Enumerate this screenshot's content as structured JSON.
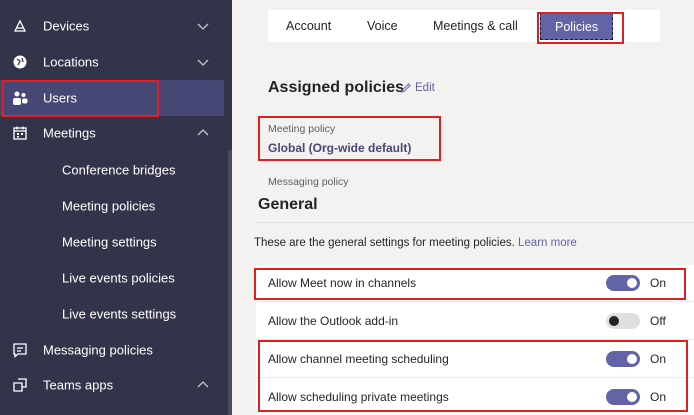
{
  "sidebar": {
    "items": [
      {
        "label": "Devices",
        "icon": "devices-icon",
        "chevron": "down"
      },
      {
        "label": "Locations",
        "icon": "globe-icon",
        "chevron": "down"
      },
      {
        "label": "Users",
        "icon": "users-icon",
        "active": true
      },
      {
        "label": "Meetings",
        "icon": "calendar-icon",
        "chevron": "up"
      },
      {
        "label": "Conference bridges",
        "sub": true
      },
      {
        "label": "Meeting policies",
        "sub": true
      },
      {
        "label": "Meeting settings",
        "sub": true
      },
      {
        "label": "Live events policies",
        "sub": true
      },
      {
        "label": "Live events settings",
        "sub": true
      },
      {
        "label": "Messaging policies",
        "icon": "message-icon"
      },
      {
        "label": "Teams apps",
        "icon": "apps-icon",
        "chevron": "up"
      }
    ]
  },
  "tabs": [
    "Account",
    "Voice",
    "Meetings & call",
    "Policies"
  ],
  "assigned": {
    "title": "Assigned policies",
    "edit": "Edit",
    "meeting_policy_label": "Meeting policy",
    "meeting_policy_value": "Global (Org-wide default)",
    "messaging_policy_label": "Messaging policy"
  },
  "general": {
    "title": "General",
    "desc": "These are the general settings for meeting policies.",
    "learn_more": "Learn more"
  },
  "settings": [
    {
      "label": "Allow Meet now in channels",
      "state": "On",
      "on": true
    },
    {
      "label": "Allow the Outlook add-in",
      "state": "Off",
      "on": false
    },
    {
      "label": "Allow channel meeting scheduling",
      "state": "On",
      "on": true
    },
    {
      "label": "Allow scheduling private meetings",
      "state": "On",
      "on": true
    }
  ],
  "colors": {
    "sidebar": "#33344a",
    "accent": "#6264a7",
    "highlight": "#e02020"
  }
}
